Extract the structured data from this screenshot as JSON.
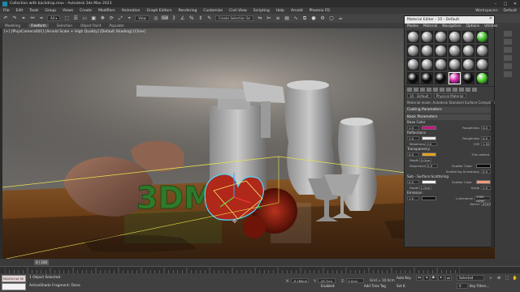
{
  "window": {
    "title": "Collection with backdrop.max - Autodesk 3ds Max 2023"
  },
  "menu": {
    "items": [
      "File",
      "Edit",
      "Tools",
      "Group",
      "Views",
      "Create",
      "Modifiers",
      "Animation",
      "Graph Editors",
      "Rendering",
      "Customize",
      "Civil View",
      "Scripting",
      "Help",
      "Arnold",
      "Phoenix FD"
    ],
    "workspaces_label": "Workspaces:",
    "workspace_value": "Default"
  },
  "toolbar": {
    "view_dropdown": "View",
    "selection_set": "Create Selection Se"
  },
  "ribbon": {
    "tabs": [
      "Modeling",
      "Freeform",
      "Selection",
      "Object Paint",
      "Populate"
    ],
    "active": "Freeform"
  },
  "viewport": {
    "label": "[+] [PhysCamera001] [Arnold Scale + High Quality] [Default Shading] [Cline]"
  },
  "material_editor": {
    "title": "Material Editor - 10 - Default",
    "menu": [
      "Modes",
      "Material",
      "Navigation",
      "Options",
      "Utilities"
    ],
    "slots": [
      {
        "color": "#9a9a9a"
      },
      {
        "color": "#9a9a9a"
      },
      {
        "color": "#9a9a9a"
      },
      {
        "color": "#9a9a9a"
      },
      {
        "color": "#9a9a9a"
      },
      {
        "color": "#46c42f"
      },
      {
        "color": "#9a9a9a"
      },
      {
        "color": "#9a9a9a"
      },
      {
        "color": "#9a9a9a"
      },
      {
        "color": "#9a9a9a"
      },
      {
        "color": "#9a9a9a"
      },
      {
        "color": "#9a9a9a"
      },
      {
        "color": "#9a9a9a"
      },
      {
        "color": "#9a9a9a"
      },
      {
        "color": "#9a9a9a"
      },
      {
        "color": "#9a9a9a"
      },
      {
        "color": "#9a9a9a"
      },
      {
        "color": "#9a9a9a"
      },
      {
        "color": "#0a0a0a"
      },
      {
        "color": "#0a0a0a"
      },
      {
        "color": "#0a0a0a"
      },
      {
        "color": "#d02aa8"
      },
      {
        "color": "#0a0a0a"
      },
      {
        "color": "#4ccf2a"
      }
    ],
    "selected_slot": 21,
    "material_name": "10 - Default",
    "material_type": "Physical Material",
    "preset_row": "Material mode: Autodesk Standard Surface Compatibl",
    "rollouts": {
      "coating": "Coating Parameters",
      "basic": "Basic Parameters"
    },
    "sections": {
      "base_color": "Base Color",
      "reflections": "Reflections",
      "transparency": "Transparency",
      "sss": "Sub - Surface Scattering",
      "emission": "Emission"
    },
    "params": {
      "base_weight": "1.0",
      "base_color": "#c4197e",
      "roughness_label": "Roughness",
      "base_roughness": "0.0",
      "refl_weight": "1.0",
      "refl_color": "#e8e8e8",
      "refl_mode": "Roughness",
      "refl_roughness": "0.0",
      "metalness_label": "Metalness",
      "metalness": "0.0",
      "ior_label": "IOR",
      "ior": "1.52",
      "trans_weight": "0.0",
      "trans_color": "#e6a321",
      "depth_label": "Depth",
      "trans_depth": "0.0cm",
      "thin_walled": "Thin-walled",
      "dispersion_label": "Dispersion",
      "dispersion": "0.0",
      "scatter_color_label": "Scatter Color",
      "trans_scatter_color": "#0a0a0a",
      "scatter_anis_label": "Scattering Anisotropy",
      "scatter_anis": "0.0",
      "sss_weight": "0.0",
      "sss_color": "#f0f0f0",
      "sss_scatter_color": "#f09a7a",
      "sss_depth": "1.0cm",
      "scale_label": "Scale",
      "sss_scale": "1.0",
      "em_weight": "1.0",
      "em_color": "#111111",
      "luminance_label": "Luminance",
      "luminance": "1500 cd/m²",
      "kelvin_label": "Kelvin",
      "kelvin": "6500.0"
    }
  },
  "timeline": {
    "frame": "0 / 100"
  },
  "status": {
    "maxscript": "MAXScript Mi",
    "selected": "1 Object Selected",
    "prompt": "ActiveShade Fragment: Done",
    "x_label": "X:",
    "x": "-9.186cm",
    "y_label": "Y:",
    "y": "-26.7cm",
    "z_label": "Z:",
    "z": "0.0cm",
    "grid": "Grid = 10.0cm",
    "enabled": "Enabled:",
    "add_time_tag": "Add Time Tag",
    "auto_key": "Auto Key",
    "set_key": "Set K.",
    "selected_dd": "Selected",
    "key_filters": "Key Filters...",
    "frame_num": "0"
  },
  "scene": {
    "logo_text": "3DMAX"
  }
}
